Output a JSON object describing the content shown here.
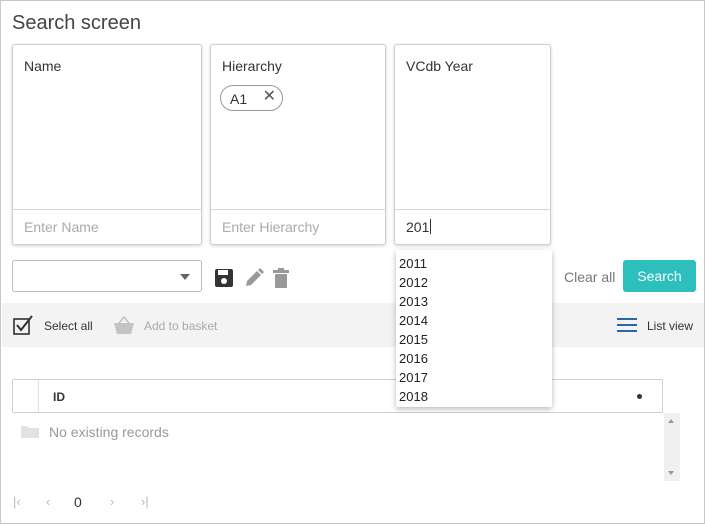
{
  "page": {
    "title": "Search screen"
  },
  "fields": {
    "name": {
      "label": "Name",
      "placeholder": "Enter Name",
      "value": ""
    },
    "hierarchy": {
      "label": "Hierarchy",
      "placeholder": "Enter Hierarchy",
      "value": "",
      "chips": [
        "A1"
      ]
    },
    "vcdb_year": {
      "label": "VCdb Year",
      "placeholder": "",
      "value": "201"
    }
  },
  "dropdown": {
    "options": [
      "2011",
      "2012",
      "2013",
      "2014",
      "2015",
      "2016",
      "2017",
      "2018"
    ]
  },
  "actions": {
    "clear_label": "Clear all",
    "search_label": "Search",
    "accent_color": "#2cbfbc"
  },
  "toolbar": {
    "select_all_label": "Select all",
    "add_to_basket_label": "Add to basket",
    "list_view_label": "List view"
  },
  "grid": {
    "columns": [
      "ID"
    ],
    "empty_message": "No existing records"
  },
  "pager": {
    "page_number": "0"
  }
}
